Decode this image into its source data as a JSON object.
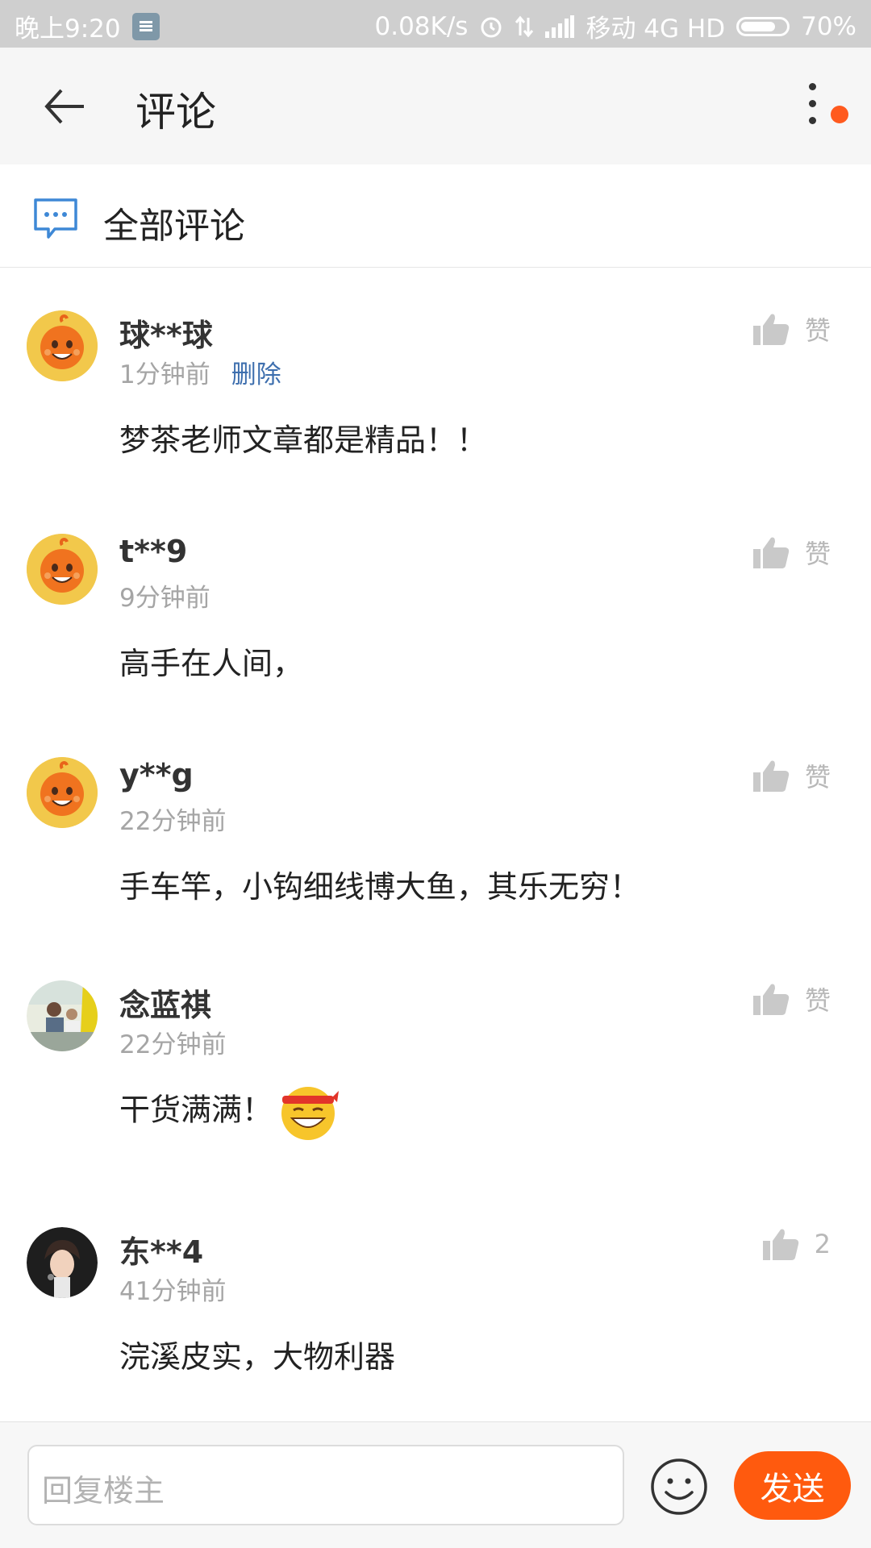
{
  "status_bar": {
    "time": "晚上9:20",
    "net_speed": "0.08K/s",
    "carrier": "移动 4G HD",
    "battery": "70%"
  },
  "header": {
    "title": "评论"
  },
  "section": {
    "title": "全部评论"
  },
  "comments": [
    {
      "user": "球**球",
      "time": "1分钟前",
      "delete_label": "删除",
      "like_label": "赞",
      "text": "梦茶老师文章都是精品！！"
    },
    {
      "user": "t**9",
      "time": "9分钟前",
      "like_label": "赞",
      "text": "高手在人间，"
    },
    {
      "user": "y**g",
      "time": "22分钟前",
      "like_label": "赞",
      "text": "手车竿，小钩细线博大鱼，其乐无穷！"
    },
    {
      "user": "念蓝祺",
      "time": "22分钟前",
      "like_label": "赞",
      "text": "干货满满！"
    },
    {
      "user": "东**4",
      "time": "41分钟前",
      "like_label": "2",
      "text": "浣溪皮实，大物利器"
    }
  ],
  "reply": {
    "placeholder": "回复楼主",
    "send_label": "发送"
  },
  "colors": {
    "accent": "#ff5a0e",
    "link": "#3e6fae",
    "muted": "#a5a5a5"
  }
}
